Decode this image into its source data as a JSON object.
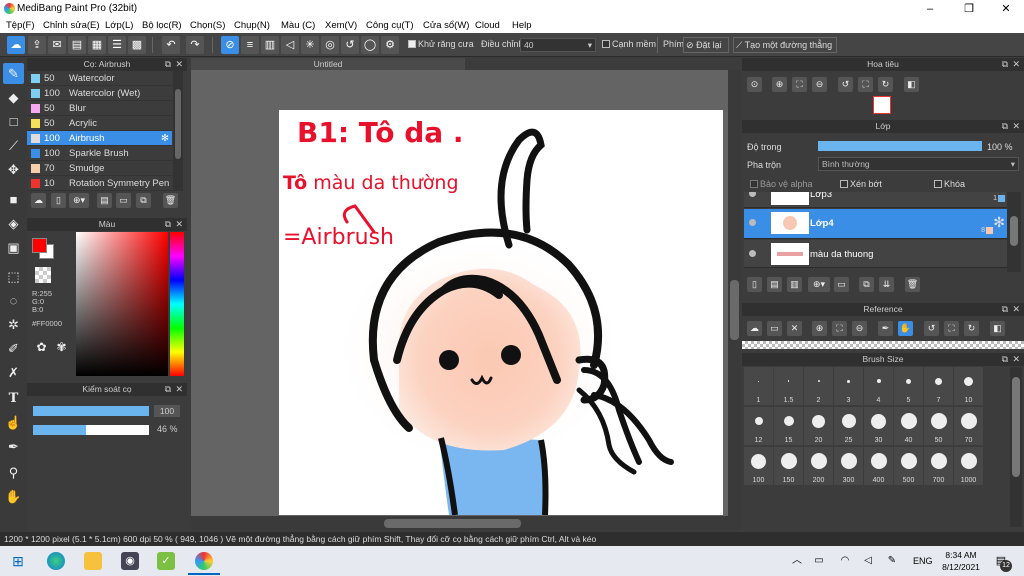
{
  "window": {
    "title": "MediBang Paint Pro (32bit)",
    "minimize": "–",
    "maximize": "❐",
    "close": "✕"
  },
  "menu": [
    "Tệp(F)",
    "Chỉnh sửa(E)",
    "Lớp(L)",
    "Bộ lọc(R)",
    "Chọn(S)",
    "Chụp(N)",
    "Màu (C)",
    "Xem(V)",
    "Công cụ(T)",
    "Cửa sổ(W)",
    "Cloud",
    "Help"
  ],
  "toolbar": {
    "antialias_label": "Khử răng cưa",
    "adjust_label": "Điều chỉnh",
    "adjust_value": "40",
    "smooth_edge_label": "Cạnh mềm",
    "key_label": "Phím",
    "reset_label": "Đặt lại",
    "line_label": "Tạo một đường thẳng"
  },
  "brush_panel": {
    "title": "Cọ: Airbrush",
    "items": [
      {
        "size": "50",
        "name": "Watercolor",
        "color": "#7fd0f0"
      },
      {
        "size": "100",
        "name": "Watercolor (Wet)",
        "color": "#7fd0f0"
      },
      {
        "size": "50",
        "name": "Blur",
        "color": "#f6a8f0"
      },
      {
        "size": "50",
        "name": "Acrylic",
        "color": "#f4e05a"
      },
      {
        "size": "100",
        "name": "Airbrush",
        "color": "#dddddd",
        "selected": true
      },
      {
        "size": "100",
        "name": "Sparkle Brush",
        "color": "#3a8ee6"
      },
      {
        "size": "70",
        "name": "Smudge",
        "color": "#f4cfae"
      },
      {
        "size": "10",
        "name": "Rotation Symmetry Pen",
        "color": "#e33"
      }
    ]
  },
  "color_panel": {
    "title": "Màu",
    "r_label": "R:255",
    "g_label": "G:0",
    "b_label": "B:0",
    "hex_label": "#FF0000",
    "primary": "#ff0000"
  },
  "control_panel": {
    "title": "Kiểm soát cọ",
    "size_value": "100",
    "opacity_value": "46 %",
    "size_fraction": 1.0,
    "opacity_fraction": 0.46
  },
  "document": {
    "tab": "Untitled",
    "text_line1": "B1: Tô da .",
    "text_line2_bold": "Tô",
    "text_line2_rest": " màu da thường",
    "text_line3": "=Airbrush"
  },
  "navigator": {
    "title": "Hoa tiêu"
  },
  "layer_panel": {
    "title": "Lớp",
    "opacity_label": "Độ trong",
    "opacity_value": "100 %",
    "opacity_fraction": 1.0,
    "blend_label": "Pha trộn",
    "blend_value": "Bình thường",
    "protect_alpha_label": "Bảo vệ alpha",
    "clipping_label": "Xén bớt",
    "lock_label": "Khóa",
    "layers": [
      {
        "name": "Lớp3",
        "num": "1"
      },
      {
        "name": "Lớp4",
        "num": "8",
        "selected": true
      },
      {
        "name": "màu da thuong",
        "num": ""
      }
    ]
  },
  "reference_panel": {
    "title": "Reference"
  },
  "brush_size_panel": {
    "title": "Brush Size",
    "sizes": [
      "1",
      "1.5",
      "2",
      "3",
      "4",
      "5",
      "7",
      "10",
      "12",
      "15",
      "20",
      "25",
      "30",
      "40",
      "50",
      "70",
      "100",
      "150",
      "200",
      "300",
      "400",
      "500",
      "700",
      "1000"
    ]
  },
  "status": "1200 * 1200 pixel   (5.1 * 5.1cm)  600 dpi  50 %  ( 949, 1046 )  Vẽ một đường thẳng bằng cách giữ phím Shift, Thay đổi cỡ cọ bằng cách giữ phím Ctrl, Alt và kéo",
  "taskbar": {
    "time": "8:34 AM",
    "date": "8/12/2021",
    "lang": "ENG",
    "notif_count": "12"
  }
}
